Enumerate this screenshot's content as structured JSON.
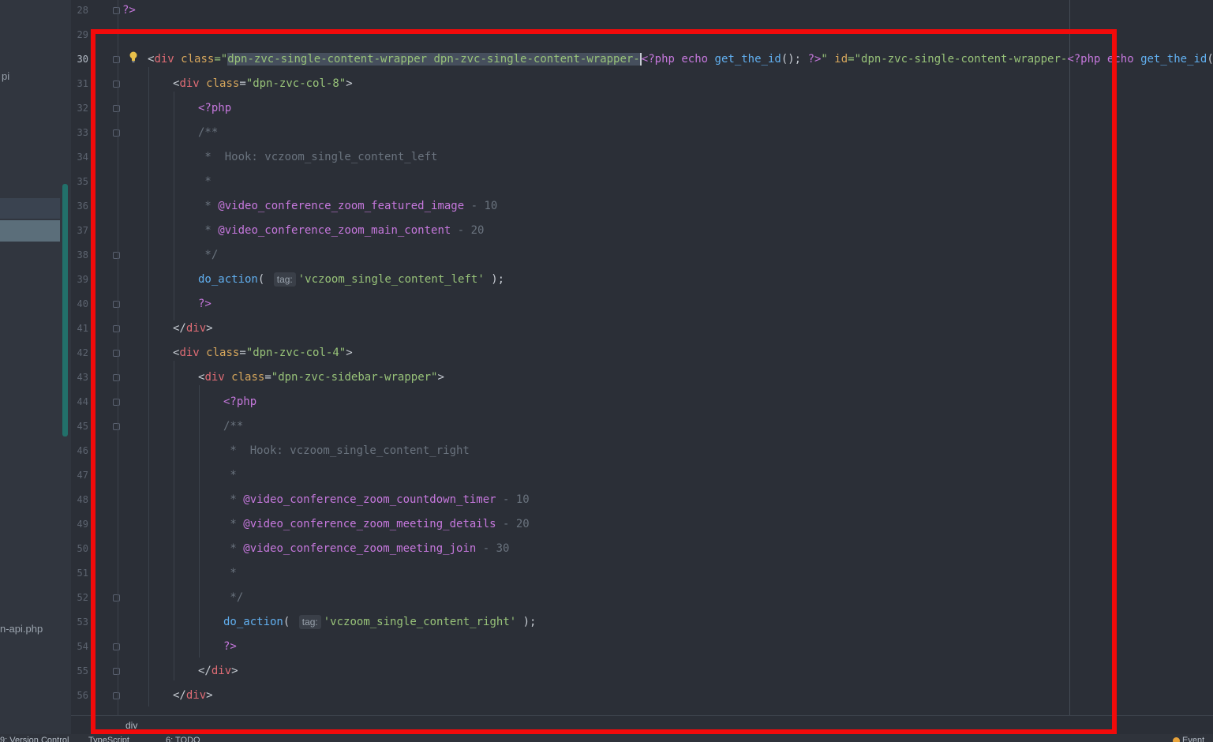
{
  "sidebar": {
    "item_top": "pi",
    "item_bottom": "n-api.php"
  },
  "gutter": {
    "line_numbers": [
      "28",
      "29",
      "30",
      "31",
      "32",
      "33",
      "34",
      "35",
      "36",
      "37",
      "38",
      "39",
      "40",
      "41",
      "42",
      "43",
      "44",
      "45",
      "46",
      "47",
      "48",
      "49",
      "50",
      "51",
      "52",
      "53",
      "54",
      "55",
      "56"
    ]
  },
  "code": {
    "l28": "?>",
    "l30": {
      "open": "<",
      "tag": "div",
      "attr_class": "class",
      "eq": "=\"",
      "sel_class": "dpn-zvc-single-content-wrapper dpn-zvc-single-content-wrapper-",
      "php_open": "<?php",
      "echo": "echo",
      "fn": "get_the_id",
      "call": "();",
      "php_close": "?>",
      "q": "\"",
      "attr_id": "id",
      "id_val": "dpn-zvc-single-content-wrapper-",
      "php_open2": "<?php",
      "echo2": "echo",
      "fn2": "get_the_id",
      "call2": "();",
      "php_close2": "?>",
      "end": "\">"
    },
    "l31": {
      "tag": "div",
      "attr": "class",
      "val": "\"dpn-zvc-col-8\""
    },
    "l32": "<?php",
    "l33": "/**",
    "l34": " *  Hook: vczoom_single_content_left",
    "l35": " *",
    "l36": {
      "star": " * ",
      "tag": "@video_conference_zoom_featured_image",
      "rest": " - 10"
    },
    "l37": {
      "star": " * ",
      "tag": "@video_conference_zoom_main_content",
      "rest": " - 20"
    },
    "l38": " */",
    "l39": {
      "fn": "do_action",
      "open": "(",
      "hint": "tag:",
      "arg": "'vczoom_single_content_left'",
      "close": " );"
    },
    "l40": "?>",
    "l41": {
      "tag": "div"
    },
    "l42": {
      "tag": "div",
      "attr": "class",
      "val": "\"dpn-zvc-col-4\""
    },
    "l43": {
      "tag": "div",
      "attr": "class",
      "val": "\"dpn-zvc-sidebar-wrapper\""
    },
    "l44": "<?php",
    "l45": "/**",
    "l46": " *  Hook: vczoom_single_content_right",
    "l47": " *",
    "l48": {
      "star": " * ",
      "tag": "@video_conference_zoom_countdown_timer",
      "rest": " - 10"
    },
    "l49": {
      "star": " * ",
      "tag": "@video_conference_zoom_meeting_details",
      "rest": " - 20"
    },
    "l50": {
      "star": " * ",
      "tag": "@video_conference_zoom_meeting_join",
      "rest": " - 30"
    },
    "l51": " *",
    "l52": " */",
    "l53": {
      "fn": "do_action",
      "open": "(",
      "hint": "tag:",
      "arg": "'vczoom_single_content_right'",
      "close": " );"
    },
    "l54": "?>",
    "l55": {
      "tag": "div"
    },
    "l56": {
      "tag": "div"
    }
  },
  "breadcrumb": "div",
  "statusbar": {
    "version_control": "9: Version Control",
    "typescript": "TypeScript",
    "todo": "6: TODO",
    "event": "Event"
  },
  "colors": {
    "editor_bg": "#2b2f37",
    "highlight_box": "#f20a0a",
    "tag": "#e06c75",
    "string": "#98c379",
    "php": "#c678dd",
    "function": "#61afef",
    "comment": "#6a737e"
  },
  "icons": {
    "intention": "lightbulb-icon",
    "fold": "fold-marker-icon"
  }
}
